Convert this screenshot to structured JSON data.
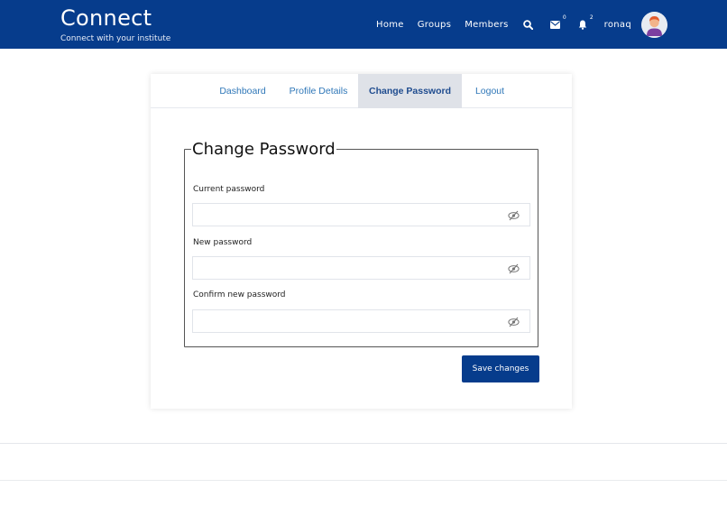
{
  "brand": {
    "title": "Connect",
    "subtitle": "Connect with your institute"
  },
  "nav": {
    "home": "Home",
    "groups": "Groups",
    "members": "Members",
    "search_icon": "search-icon",
    "messages_badge": "0",
    "notifications_badge": "2",
    "username": "ronaq"
  },
  "tabs": [
    {
      "label": "Dashboard",
      "active": false
    },
    {
      "label": "Profile Details",
      "active": false
    },
    {
      "label": "Change Password",
      "active": true
    },
    {
      "label": "Logout",
      "active": false
    }
  ],
  "form": {
    "legend": "Change Password",
    "current_label": "Current password",
    "current_value": "",
    "new_label": "New password",
    "new_value": "",
    "confirm_label": "Confirm new password",
    "confirm_value": "",
    "save_label": "Save changes"
  },
  "colors": {
    "primary": "#063c8c",
    "link": "#2f77b8",
    "active_tab_bg": "#dfe2e8"
  }
}
